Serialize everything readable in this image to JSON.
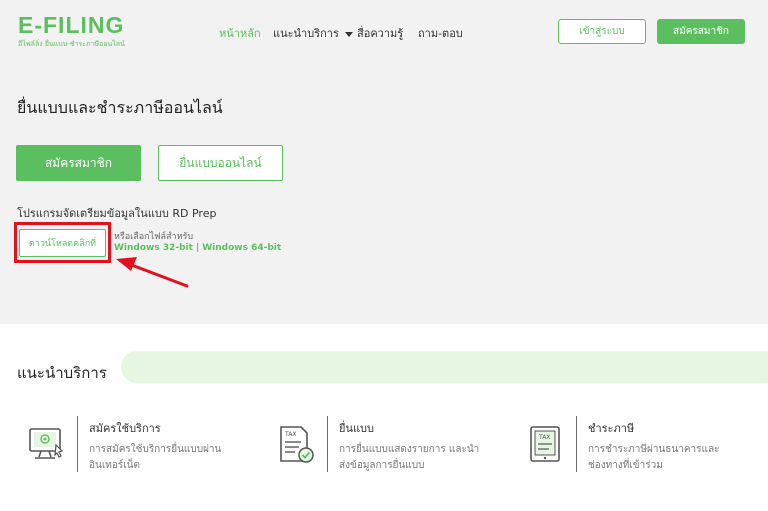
{
  "header": {
    "logo_text": "E-FILING",
    "logo_subtext": "อีไฟล์ลิ่ง ยื่นแบบ-ชำระภาษีออนไลน์",
    "nav": {
      "home": "หน้าหลัก",
      "services": "แนะนำบริการ",
      "media": "สื่อความรู้",
      "faq": "ถาม-ตอบ"
    },
    "login_label": "เข้าสู่ระบบ",
    "register_label": "สมัครสมาชิก"
  },
  "hero": {
    "title": "ยื่นแบบและชำระภาษีออนไลน์",
    "register_button": "สมัครสมาชิก",
    "file_online_button": "ยื่นแบบออนไลน์",
    "rdprep_title": "โปรแกรมจัดเตรียมข้อมูลในแบบ RD Prep",
    "download_button": "ดาวน์โหลดคลิกที่",
    "or_choose": "หรือเลือกไฟล์สำหรับ",
    "win32": "Windows 32-bit",
    "separator": "|",
    "win64": "Windows 64-bit"
  },
  "services": {
    "title": "แนะนำบริการ",
    "items": [
      {
        "title": "สมัครใช้บริการ",
        "desc1": "การสมัครใช้บริการยื่นแบบผ่าน",
        "desc2": "อินเทอร์เน็ต",
        "icon": "computer-register-icon"
      },
      {
        "title": "ยื่นแบบ",
        "desc1": "การยื่นแบบแสดงรายการ และนำ",
        "desc2": "ส่งข้อมูลการยื่นแบบ",
        "icon": "tax-form-check-icon",
        "icon_label": "TAX"
      },
      {
        "title": "ชำระภาษี",
        "desc1": "การชำระภาษีผ่านธนาคารและ",
        "desc2": "ช่องทางที่เข้าร่วม",
        "icon": "tax-tablet-icon",
        "icon_label": "TAX"
      }
    ]
  },
  "colors": {
    "brand_green": "#5cbf5f",
    "highlight_red": "#e2111e",
    "services_bar": "#e6f6e3"
  }
}
